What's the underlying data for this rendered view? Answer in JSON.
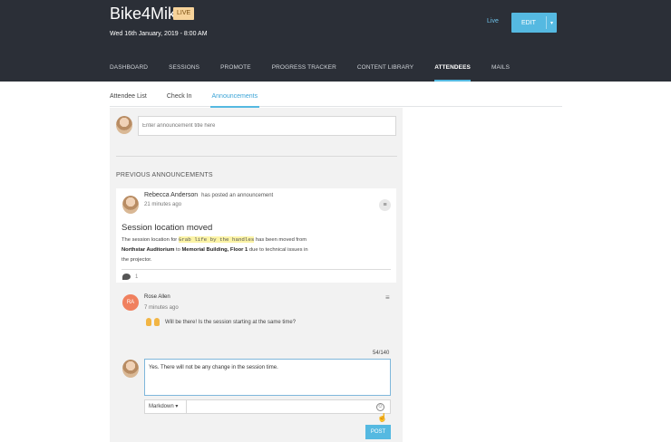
{
  "header": {
    "app_title": "Bike4Mike",
    "live_badge": "LIVE",
    "event_date": "Wed 16th January, 2019 - 8:00 AM",
    "live_link": "Live",
    "edit_label": "EDIT",
    "edit_caret": "▾"
  },
  "nav": {
    "items": [
      "DASHBOARD",
      "SESSIONS",
      "PROMOTE",
      "PROGRESS TRACKER",
      "CONTENT LIBRARY",
      "ATTENDEES",
      "MAILS"
    ],
    "active": "ATTENDEES"
  },
  "subtabs": {
    "items": [
      "Attendee List",
      "Check In",
      "Announcements"
    ],
    "active": "Announcements"
  },
  "compose": {
    "placeholder": "Enter announcement title here"
  },
  "previous": {
    "title": "PREVIOUS ANNOUNCEMENTS"
  },
  "announcement": {
    "author": "Rebecca Anderson",
    "action": "has posted an announcement",
    "time": "21 minutes ago",
    "menu_icon": "≡",
    "heading": "Session location moved",
    "body": {
      "part1": "The session location for ",
      "highlight": "Grab life by the handles",
      "part2": " has been moved from ",
      "from_location": "Northstar Auditorium",
      "part3": " to ",
      "to_location": "Memorial Building, Floor 1",
      "part4": " due to technical issues in the projector."
    },
    "comment_count": "1"
  },
  "reply": {
    "initials": "RA",
    "author": "Rose Allen",
    "time": "7 minutes ago",
    "menu_icon": "≡",
    "text": "Will be there! Is the session starting at the same time?"
  },
  "composer": {
    "char_count": "54/140",
    "value": "Yes. There will not be any change in the session time.",
    "format_label": "Markdown ▾",
    "emoji_icon": "☺",
    "post_label": "POST"
  },
  "colors": {
    "header_bg": "#2b2f37",
    "accent": "#55b9e1",
    "live_badge": "#f7d39a",
    "highlight": "#fbf3a6",
    "reply_avatar": "#f0805e"
  }
}
